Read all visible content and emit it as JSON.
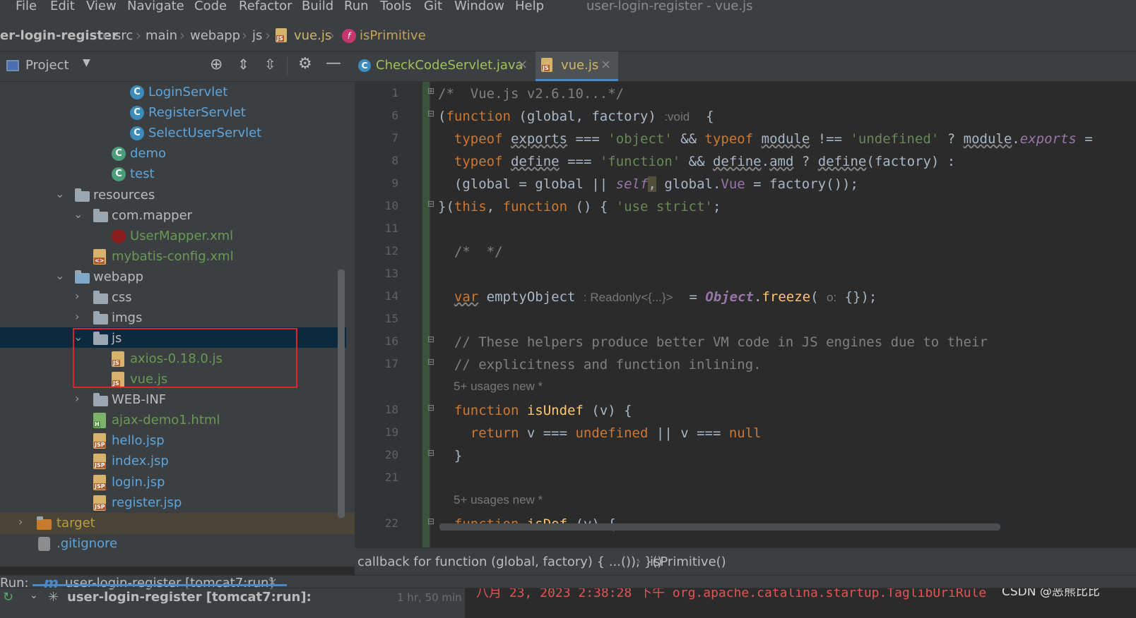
{
  "menu": {
    "items": [
      "File",
      "Edit",
      "View",
      "Navigate",
      "Code",
      "Refactor",
      "Build",
      "Run",
      "Tools",
      "Git",
      "Window",
      "Help"
    ],
    "window_title": "user-login-register - vue.js"
  },
  "breadcrumb": {
    "items": [
      "er-login-register",
      "src",
      "main",
      "webapp",
      "js",
      "vue.js",
      "isPrimitive"
    ]
  },
  "project_panel": {
    "title": "Project",
    "tree": [
      {
        "label": "LoginServlet",
        "icon": "class-icon",
        "color": "#5da5dc"
      },
      {
        "label": "RegisterServlet",
        "icon": "class-icon",
        "color": "#5da5dc"
      },
      {
        "label": "SelectUserServlet",
        "icon": "class-icon",
        "color": "#5da5dc"
      },
      {
        "label": "demo",
        "icon": "class-icon",
        "color": "#5da5dc"
      },
      {
        "label": "test",
        "icon": "class-icon",
        "color": "#5da5dc"
      },
      {
        "label": "resources",
        "icon": "folder-icon",
        "color": "#bbbbbb",
        "expanded": true
      },
      {
        "label": "com.mapper",
        "icon": "folder-icon",
        "color": "#bbbbbb",
        "expanded": true
      },
      {
        "label": "UserMapper.xml",
        "icon": "mybatis-icon",
        "color": "#6a9955"
      },
      {
        "label": "mybatis-config.xml",
        "icon": "xml-icon",
        "color": "#6a9955"
      },
      {
        "label": "webapp",
        "icon": "web-folder-icon",
        "color": "#bbbbbb",
        "expanded": true
      },
      {
        "label": "css",
        "icon": "folder-icon",
        "color": "#bbbbbb",
        "expanded": false
      },
      {
        "label": "imgs",
        "icon": "folder-icon",
        "color": "#bbbbbb",
        "expanded": false
      },
      {
        "label": "js",
        "icon": "folder-icon",
        "color": "#bbbbbb",
        "expanded": true,
        "selected": true
      },
      {
        "label": "axios-0.18.0.js",
        "icon": "js-file-icon",
        "color": "#6a9955"
      },
      {
        "label": "vue.js",
        "icon": "js-file-icon",
        "color": "#6a9955"
      },
      {
        "label": "WEB-INF",
        "icon": "folder-icon",
        "color": "#bbbbbb",
        "expanded": false
      },
      {
        "label": "ajax-demo1.html",
        "icon": "html-file-icon",
        "color": "#6a9955"
      },
      {
        "label": "hello.jsp",
        "icon": "jsp-file-icon",
        "color": "#5da5dc"
      },
      {
        "label": "index.jsp",
        "icon": "jsp-file-icon",
        "color": "#5da5dc"
      },
      {
        "label": "login.jsp",
        "icon": "jsp-file-icon",
        "color": "#5da5dc"
      },
      {
        "label": "register.jsp",
        "icon": "jsp-file-icon",
        "color": "#5da5dc"
      },
      {
        "label": "target",
        "icon": "orange-folder-icon",
        "color": "#b99d3e",
        "expanded": false
      },
      {
        "label": ".gitignore",
        "icon": "gitignore-icon",
        "color": "#5da5dc"
      }
    ]
  },
  "editor": {
    "tabs": [
      {
        "label": "CheckCodeServlet.java",
        "active": false
      },
      {
        "label": "vue.js",
        "active": true
      }
    ],
    "line_numbers": [
      "1",
      "6",
      "7",
      "8",
      "9",
      "10",
      "11",
      "12",
      "13",
      "14",
      "15",
      "16",
      "17",
      "",
      "18",
      "19",
      "20",
      "21",
      "",
      "22"
    ],
    "usages_hint": "5+ usages    new *",
    "status_path": "callback for function (global, factory) { ...()); }()",
    "status_method": "isPrimitive()"
  },
  "run_panel": {
    "label": "Run:",
    "tab": "user-login-register [tomcat7:run]",
    "tree_item": "user-login-register [tomcat7:run]:",
    "elapsed": "1 hr, 50 min",
    "log_line": "八月 23, 2023 2:38:28 下午 org.apache.catalina.startup.TaglibUriRule",
    "watermark": "CSDN @恶熊比比"
  },
  "colors": {
    "highlight_box": "#e0242b",
    "selection": "#0d293e",
    "accent": "#4a88c7"
  }
}
